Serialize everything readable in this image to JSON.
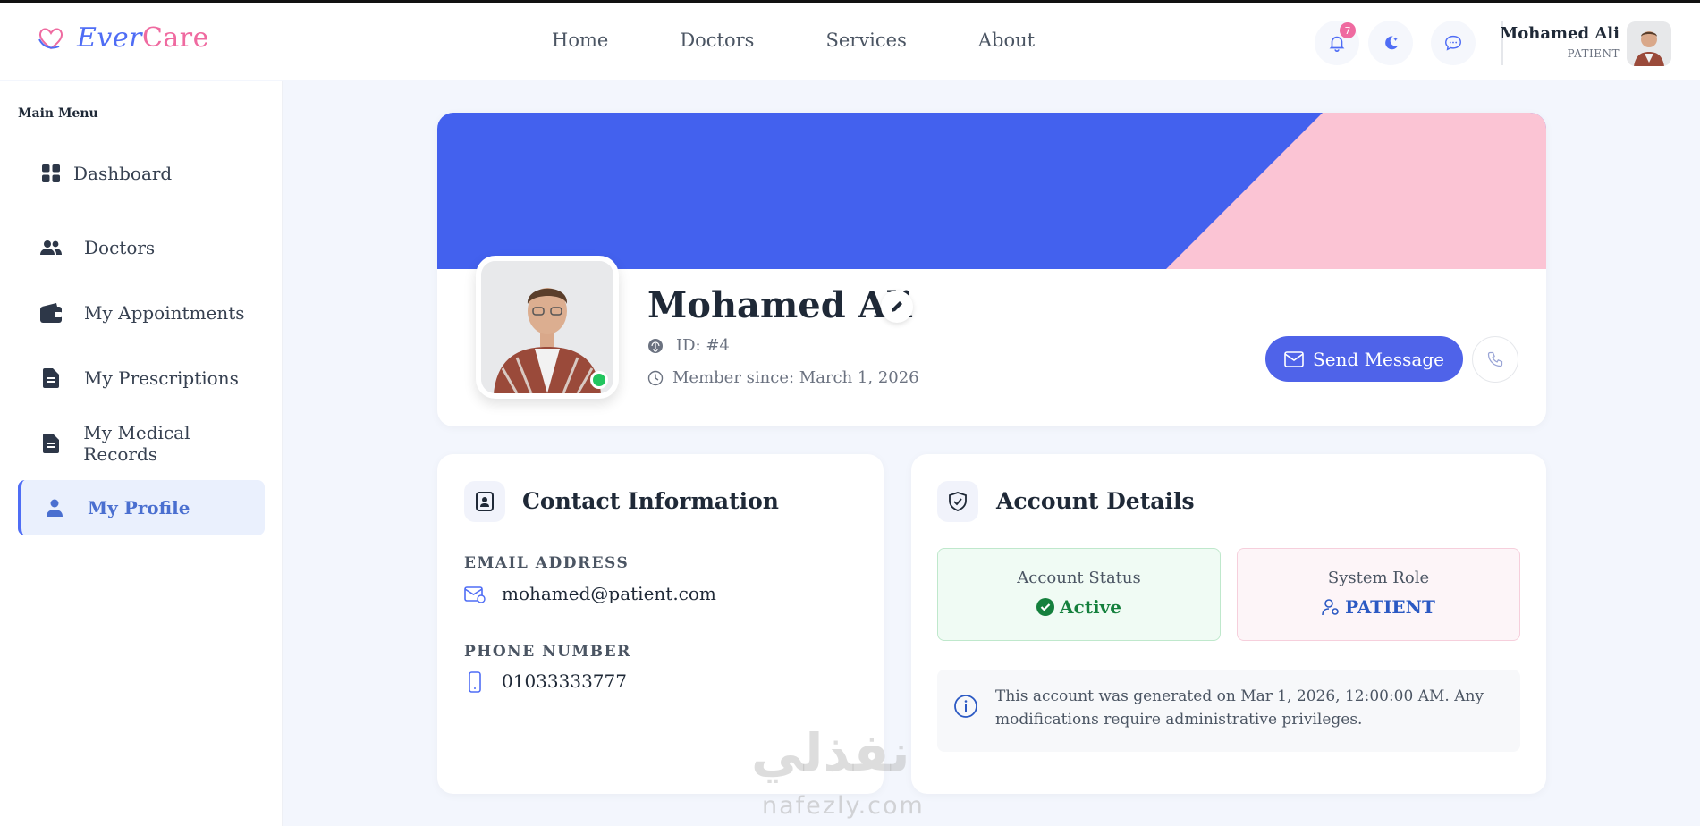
{
  "app": {
    "logo_first": "Ever",
    "logo_second": "Care"
  },
  "nav": {
    "items": [
      "Home",
      "Doctors",
      "Services",
      "About"
    ]
  },
  "header": {
    "notification_count": "7",
    "user_name": "Mohamed Ali",
    "user_role": "PATIENT"
  },
  "sidebar": {
    "title": "Main Menu",
    "items": [
      {
        "label": "Dashboard",
        "icon": "grid-icon"
      },
      {
        "label": "Doctors",
        "icon": "users-icon"
      },
      {
        "label": "My Appointments",
        "icon": "wallet-icon"
      },
      {
        "label": "My Prescriptions",
        "icon": "document-icon"
      },
      {
        "label": "My Medical Records",
        "icon": "document-icon"
      },
      {
        "label": "My Profile",
        "icon": "user-icon"
      }
    ],
    "active_index": 5
  },
  "profile": {
    "name": "Mohamed Ali",
    "id_text": "ID: #4",
    "member_since": "Member since: March 1, 2026",
    "send_message_label": "Send Message",
    "banner_colors": {
      "left": "#4361ee",
      "right": "#fbc4d4"
    }
  },
  "contact": {
    "title": "Contact Information",
    "email_label": "EMAIL ADDRESS",
    "email_value": "mohamed@patient.com",
    "phone_label": "PHONE NUMBER",
    "phone_value": "01033333777"
  },
  "account": {
    "title": "Account Details",
    "status_label": "Account Status",
    "status_value": "Active",
    "role_label": "System Role",
    "role_value": "PATIENT",
    "info_text": "This account was generated on Mar 1, 2026, 12:00:00 AM. Any modifications require administrative privileges."
  },
  "watermark": {
    "arabic": "نفذلي",
    "latin": "nafezly.com"
  }
}
